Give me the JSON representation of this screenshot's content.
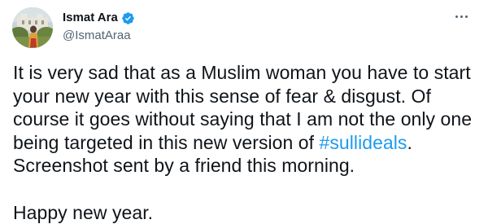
{
  "author": {
    "display_name": "Ismat Ara",
    "handle": "@IsmatAraa",
    "verified": true
  },
  "tweet": {
    "text_part1": "It is very sad that as a Muslim woman you have to start\nyour new year with this sense of fear & disgust. Of\ncourse it goes without saying that I am not the only one\nbeing targeted in this new version of ",
    "hashtag": "#sullideals",
    "text_part2": ".\nScreenshot sent by a friend this morning.\n\nHappy new year."
  },
  "colors": {
    "text": "#0f1419",
    "secondary": "#536471",
    "accent": "#1d9bf0"
  },
  "icons": {
    "verified": "verified-badge-icon",
    "more": "more-horizontal-icon"
  }
}
